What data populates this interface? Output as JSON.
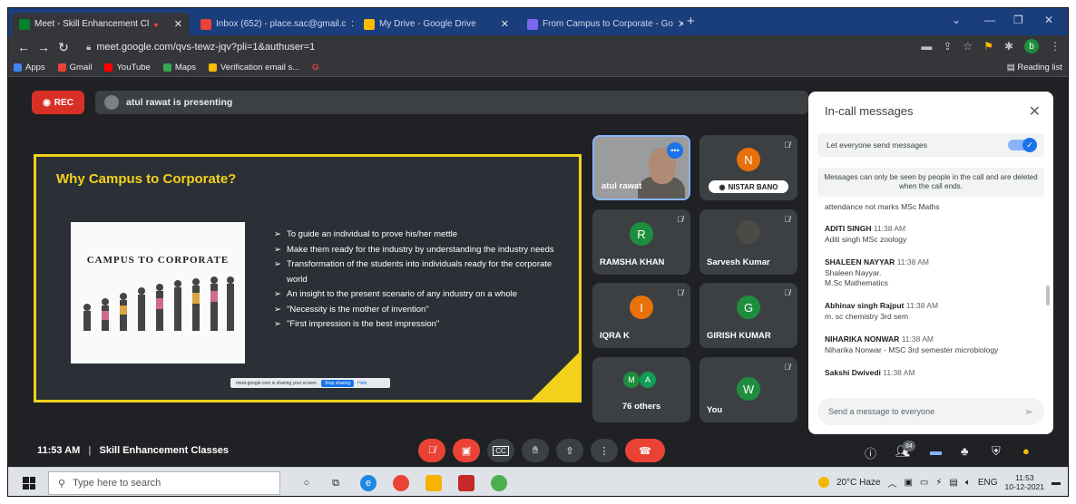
{
  "browser": {
    "tabs": [
      {
        "title": "Meet - Skill Enhancement Cl",
        "active": true
      },
      {
        "title": "Inbox (652) - place.sac@gmail.c",
        "active": false
      },
      {
        "title": "My Drive - Google Drive",
        "active": false
      },
      {
        "title": "From Campus to Corporate - Go",
        "active": false
      }
    ],
    "new_tab": "+",
    "url": "meet.google.com/qvs-tewz-jqv?pli=1&authuser=1",
    "profile_initial": "b",
    "bookmarks": [
      "Apps",
      "Gmail",
      "YouTube",
      "Maps",
      "Verification email s...",
      "G"
    ],
    "reading_list": "Reading list"
  },
  "meet": {
    "rec_label": "REC",
    "presenting_text": "atul rawat is presenting",
    "slide": {
      "title": "Why Campus to Corporate?",
      "book_title": "CAMPUS TO CORPORATE",
      "bullets": [
        "To guide an individual to prove his/her mettle",
        "Make them ready for the industry by understanding the industry needs",
        "Transformation of the students into individuals ready for the corporate world",
        "An insight to the present scenario of any industry on a whole",
        "\"Necessity is  the mother of invention\"",
        "\"First impression is the best impression\""
      ],
      "share_text": "meet.google.com is sharing your screen.",
      "stop_sharing": "Stop sharing",
      "hide": "Hide"
    },
    "tiles": {
      "atul": {
        "name": "atul rawat",
        "more": "•••"
      },
      "nistar": {
        "initial": "N",
        "name": "NISTAR BANO",
        "color": "#e8710a"
      },
      "ramsha": {
        "initial": "R",
        "name": "RAMSHA KHAN",
        "color": "#1e8e3e"
      },
      "sarvesh": {
        "name": "Sarvesh Kumar"
      },
      "iqra": {
        "initial": "I",
        "name": "IQRA K",
        "color": "#e8710a"
      },
      "girish": {
        "initial": "G",
        "name": "GIRISH KUMAR",
        "color": "#1e8e3e"
      },
      "others": {
        "initial_a": "M",
        "initial_b": "A",
        "label": "76 others"
      },
      "you": {
        "initial": "W",
        "name": "You",
        "color": "#1e8e3e"
      }
    }
  },
  "chat": {
    "title": "In-call messages",
    "toggle_label": "Let everyone send messages",
    "notice": "Messages can only be seen by people in the call and are deleted when the call ends.",
    "cutoff_text": "attendance not marks MSc Maths",
    "messages": [
      {
        "sender": "ADITI SINGH",
        "time": "11:38 AM",
        "lines": [
          "Aditi singh MSc zoology"
        ]
      },
      {
        "sender": "SHALEEN NAYYAR",
        "time": "11:38 AM",
        "lines": [
          "Shaleen Nayyar.",
          "M.Sc Mathematics"
        ]
      },
      {
        "sender": "Abhinav singh Rajput",
        "time": "11:38 AM",
        "lines": [
          "m. sc chemistry 3rd sem"
        ]
      },
      {
        "sender": "NIHARIKA NONWAR",
        "time": "11:38 AM",
        "lines": [
          "Niharika Nonwar - MSC 3rd semester microbiology"
        ]
      },
      {
        "sender": "Sakshi Dwivedi",
        "time": "11:38 AM",
        "lines": []
      }
    ],
    "input_placeholder": "Send a message to everyone"
  },
  "bottom_bar": {
    "time": "11:53 AM",
    "separator": "|",
    "meeting_name": "Skill Enhancement Classes",
    "participant_count": "84"
  },
  "taskbar": {
    "search_placeholder": "Type here to search",
    "weather": "20°C Haze",
    "language": "ENG",
    "time": "11:53",
    "date": "10-12-2021"
  }
}
